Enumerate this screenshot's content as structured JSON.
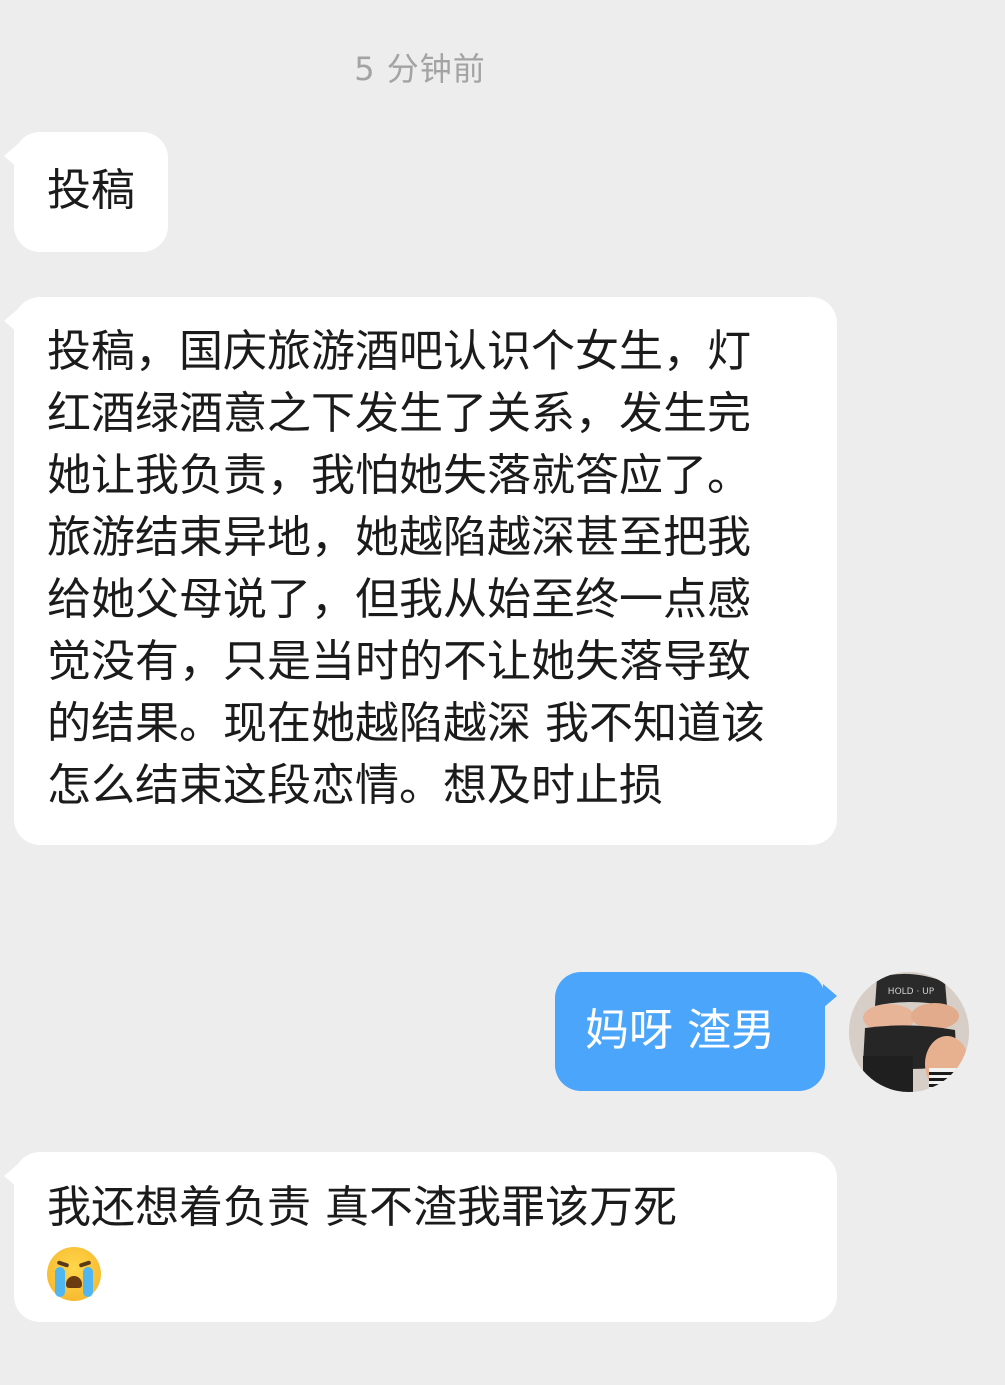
{
  "chat": {
    "timestamp": "5 分钟前",
    "messages": [
      {
        "direction": "incoming",
        "text": "投稿"
      },
      {
        "direction": "incoming",
        "text": "投稿，国庆旅游酒吧认识个女生，灯红酒绿酒意之下发生了关系，发生完她让我负责，我怕她失落就答应了。旅游结束异地，她越陷越深甚至把我给她父母说了，但我从始至终一点感觉没有，只是当时的不让她失落导致的结果。现在她越陷越深 我不知道该怎么结束这段恋情。想及时止损"
      },
      {
        "direction": "outgoing",
        "text": "妈呀 渣男"
      },
      {
        "direction": "incoming",
        "text": "我还想着负责 真不渣我罪该万死",
        "emoji": "loudly-crying-face-icon"
      }
    ]
  },
  "colors": {
    "background": "#ededed",
    "incoming_bubble": "#ffffff",
    "outgoing_bubble": "#4aa5fb",
    "timestamp_text": "#a3a3a3"
  }
}
